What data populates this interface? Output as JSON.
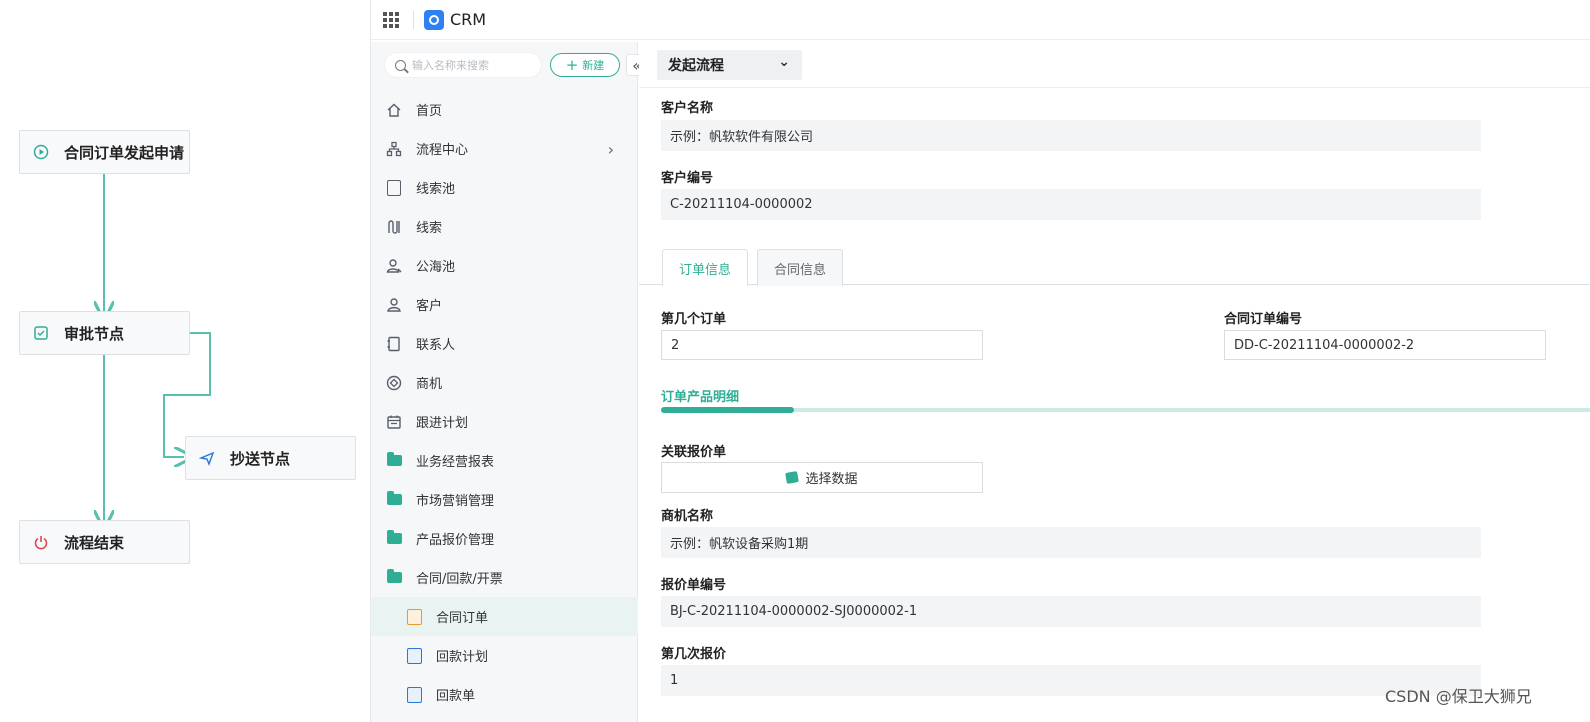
{
  "flow": {
    "start": "合同订单发起申请",
    "approve": "审批节点",
    "cc": "抄送节点",
    "end": "流程结束",
    "line_color": "#5bbfae"
  },
  "topbar": {
    "app_name": "CRM"
  },
  "sidebar": {
    "search_placeholder": "输入名称来搜索",
    "new_label": "新建",
    "items": [
      {
        "label": "首页",
        "icon": "home-icon"
      },
      {
        "label": "流程中心",
        "icon": "flow-icon",
        "has_children": true
      },
      {
        "label": "线索池",
        "icon": "lead-pool-icon"
      },
      {
        "label": "线索",
        "icon": "lead-icon"
      },
      {
        "label": "公海池",
        "icon": "public-pool-icon"
      },
      {
        "label": "客户",
        "icon": "customer-icon"
      },
      {
        "label": "联系人",
        "icon": "contact-icon"
      },
      {
        "label": "商机",
        "icon": "opportunity-icon"
      },
      {
        "label": "跟进计划",
        "icon": "calendar-icon"
      },
      {
        "label": "业务经营报表",
        "icon": "folder-icon"
      },
      {
        "label": "市场营销管理",
        "icon": "folder-icon"
      },
      {
        "label": "产品报价管理",
        "icon": "folder-icon"
      },
      {
        "label": "合同/回款/开票",
        "icon": "folder-open-icon"
      },
      {
        "label": "合同订单",
        "icon": "contract-order-icon",
        "active": true
      },
      {
        "label": "回款计划",
        "icon": "payment-plan-icon"
      },
      {
        "label": "回款单",
        "icon": "payment-receipt-icon"
      }
    ]
  },
  "main": {
    "process_select": "发起流程",
    "customer_name_label": "客户名称",
    "customer_name_value": "示例：帆软软件有限公司",
    "customer_no_label": "客户编号",
    "customer_no_value": "C-20211104-0000002",
    "tabs": [
      "订单信息",
      "合同信息"
    ],
    "order_index_label": "第几个订单",
    "order_index_value": "2",
    "contract_order_no_label": "合同订单编号",
    "contract_order_no_value": "DD-C-20211104-0000002-2",
    "section_title": "订单产品明细",
    "quote_link_label": "关联报价单",
    "select_data_label": "选择数据",
    "opportunity_name_label": "商机名称",
    "opportunity_name_value": "示例：帆软设备采购1期",
    "quote_no_label": "报价单编号",
    "quote_no_value": "BJ-C-20211104-0000002-SJ0000002-1",
    "quote_times_label": "第几次报价",
    "quote_times_value": "1"
  },
  "watermark": "CSDN @保卫大狮兄",
  "colors": {
    "accent": "#2fae95",
    "brand": "#2f7ff5"
  }
}
